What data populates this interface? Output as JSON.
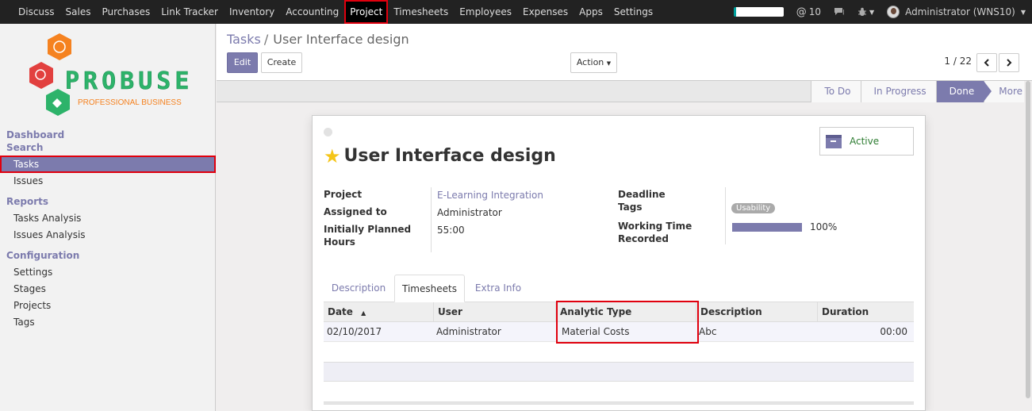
{
  "topbar": {
    "menu": [
      "Discuss",
      "Sales",
      "Purchases",
      "Link Tracker",
      "Inventory",
      "Accounting",
      "Project",
      "Timesheets",
      "Employees",
      "Expenses",
      "Apps",
      "Settings"
    ],
    "active_menu": "Project",
    "mentions_count": "10",
    "user_name": "Administrator (WNS10)"
  },
  "sidebar": {
    "logo_text": "PROBUSE",
    "logo_subtext": "PROFESSIONAL BUSINESS",
    "sections": {
      "dashboard": "Dashboard",
      "search": "Search",
      "reports": "Reports",
      "configuration": "Configuration"
    },
    "items": {
      "tasks": "Tasks",
      "issues": "Issues",
      "tasks_analysis": "Tasks Analysis",
      "issues_analysis": "Issues Analysis",
      "settings": "Settings",
      "stages": "Stages",
      "projects": "Projects",
      "tags": "Tags"
    }
  },
  "control": {
    "breadcrumb_parent": "Tasks",
    "breadcrumb_separator": "/",
    "breadcrumb_current": "User Interface design",
    "edit_label": "Edit",
    "create_label": "Create",
    "action_label": "Action",
    "pager": "1 / 22"
  },
  "stages": [
    "To Do",
    "In Progress",
    "Done",
    "More"
  ],
  "active_stage": "Done",
  "task": {
    "title": "User Interface design",
    "starred": true,
    "active_label": "Active",
    "fields": {
      "project_label": "Project",
      "project_value": "E-Learning Integration",
      "assigned_label": "Assigned to",
      "assigned_value": "Administrator",
      "planned_label_1": "Initially Planned",
      "planned_label_2": "Hours",
      "planned_value": "55:00",
      "deadline_label": "Deadline",
      "tags_label": "Tags",
      "tag_value": "Usability",
      "working_label_1": "Working Time",
      "working_label_2": "Recorded",
      "working_percent": "100%",
      "working_progress": 1.0
    }
  },
  "tabs": [
    "Description",
    "Timesheets",
    "Extra Info"
  ],
  "active_tab": "Timesheets",
  "timesheet_table": {
    "columns": [
      "Date",
      "User",
      "Analytic Type",
      "Description",
      "Duration"
    ],
    "rows": [
      {
        "date": "02/10/2017",
        "user": "Administrator",
        "analytic_type": "Material Costs",
        "description": "Abc",
        "duration": "00:00"
      }
    ]
  },
  "colors": {
    "accent": "#7c7bad",
    "highlight": "#e0000e",
    "navbar": "#222222",
    "active_green": "#2e7d32"
  }
}
